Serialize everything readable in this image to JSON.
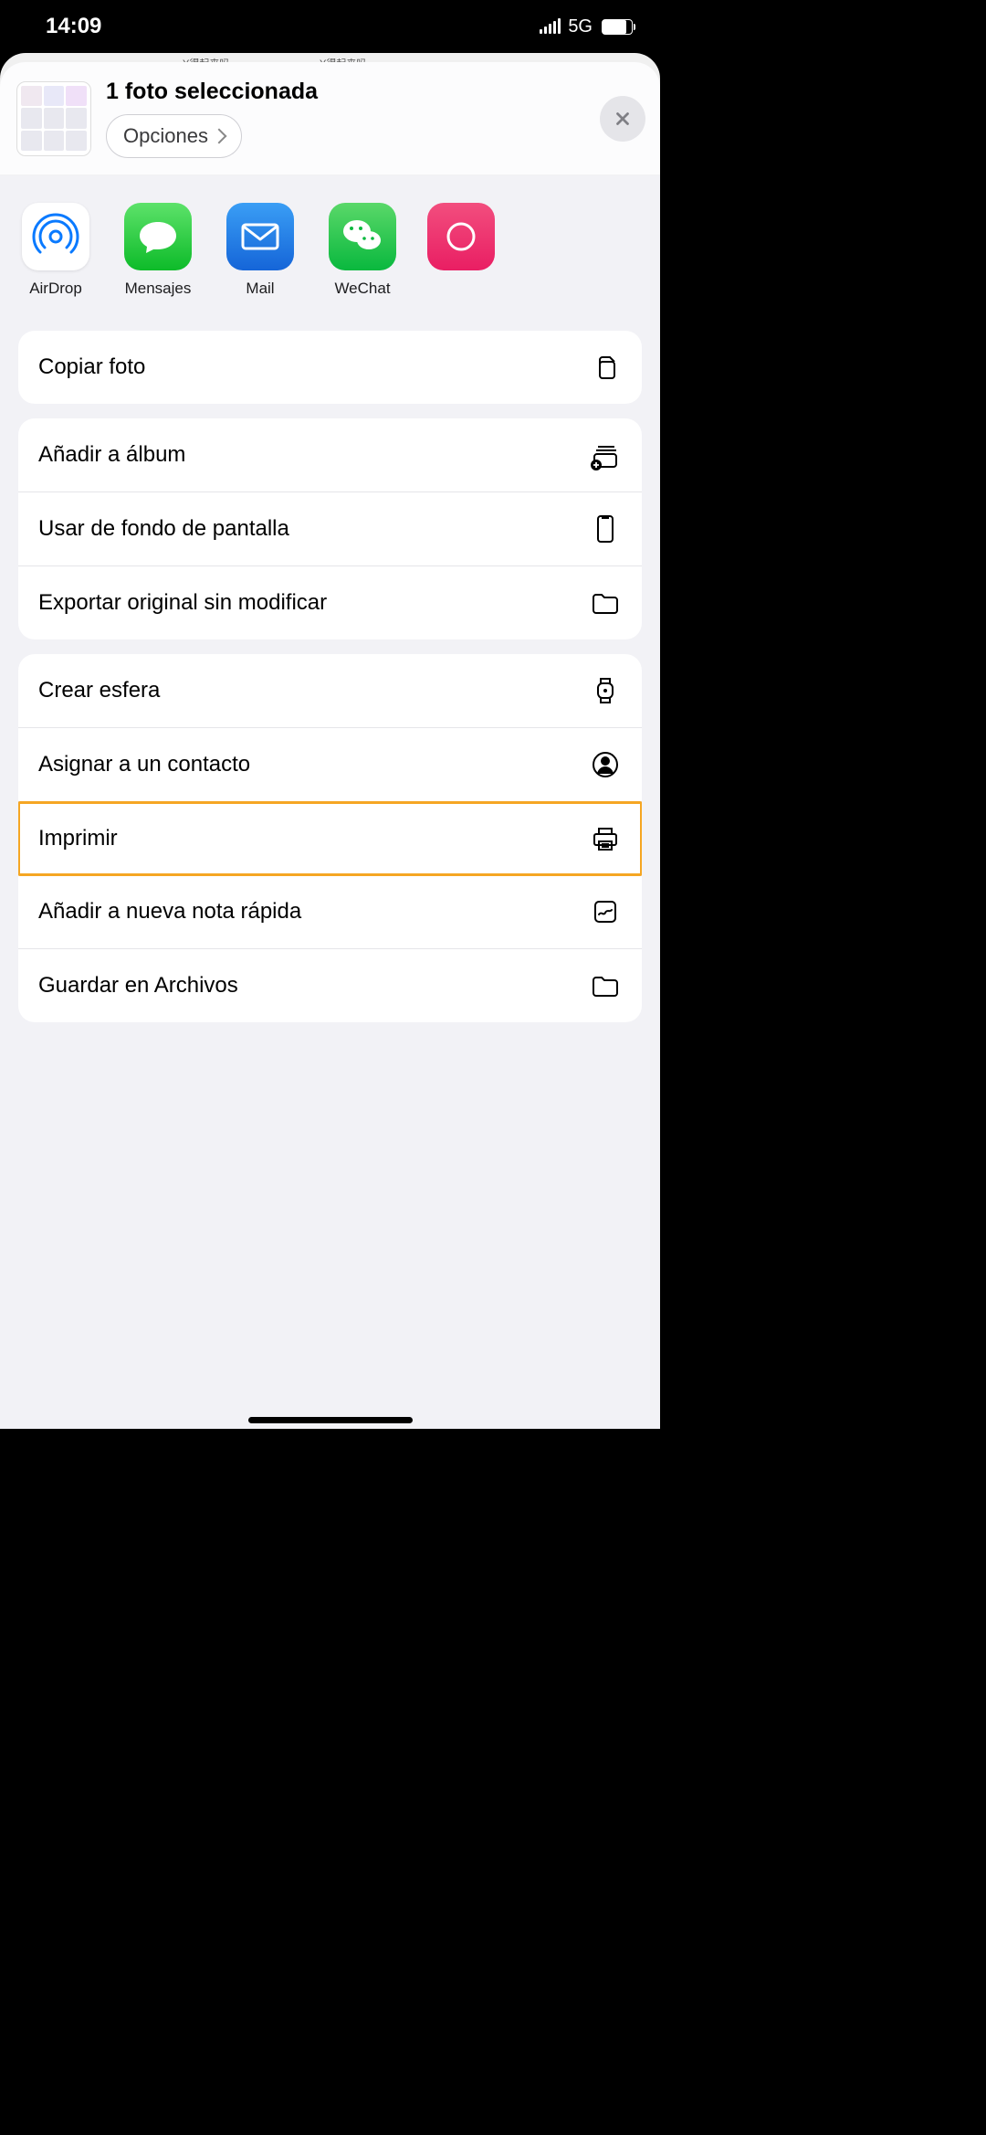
{
  "status": {
    "time": "14:09",
    "network": "5G"
  },
  "header": {
    "title": "1 foto seleccionada",
    "options": "Opciones"
  },
  "apps": {
    "airdrop": "AirDrop",
    "messages": "Mensajes",
    "mail": "Mail",
    "wechat": "WeChat"
  },
  "actions": {
    "copy": "Copiar foto",
    "addAlbum": "Añadir a álbum",
    "wallpaper": "Usar de fondo de pantalla",
    "export": "Exportar original sin modificar",
    "watchface": "Crear esfera",
    "assignContact": "Asignar a un contacto",
    "print": "Imprimir",
    "quickNote": "Añadir a nueva nota rápida",
    "saveFiles": "Guardar en Archivos"
  },
  "bgTabs": {
    "t2": "Y得起来吗",
    "t3": "Y得起来吗"
  }
}
